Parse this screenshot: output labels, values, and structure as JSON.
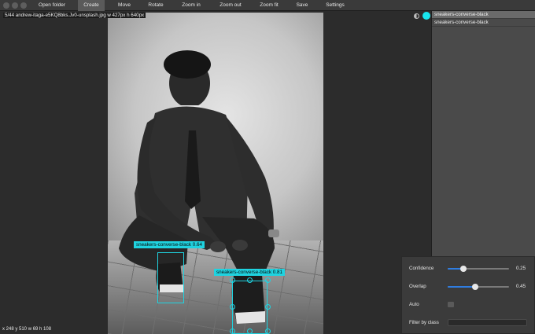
{
  "toolbar": {
    "items": [
      {
        "label": "Open folder",
        "active": false
      },
      {
        "label": "Create",
        "active": true
      },
      {
        "label": "Move",
        "active": false
      },
      {
        "label": "Rotate",
        "active": false
      },
      {
        "label": "Zoom in",
        "active": false
      },
      {
        "label": "Zoom out",
        "active": false
      },
      {
        "label": "Zoom fit",
        "active": false
      },
      {
        "label": "Save",
        "active": false
      },
      {
        "label": "Settings",
        "active": false
      }
    ]
  },
  "canvas": {
    "file_info": "5/44 andrew-itaga-e5KQ8bks.Jv0-unsplash.jpg w 427px h 640px",
    "cursor_readout": "x 248 y 510 w 69 h 108"
  },
  "detections": [
    {
      "label": "sneakers-converse-black 0.64",
      "class": "sneakers-converse-black",
      "confidence": 0.64
    },
    {
      "label": "sneakers-converse-black 0.81",
      "class": "sneakers-converse-black",
      "confidence": 0.81
    }
  ],
  "class_list": {
    "items": [
      {
        "label": "sneakers-converse-black",
        "selected": true
      },
      {
        "label": "sneakers-converse-black",
        "selected": false
      }
    ],
    "active_color": "#18e6ee"
  },
  "settings": {
    "confidence": {
      "label": "Confidence",
      "value": "0.25",
      "fraction": 0.25
    },
    "overlap": {
      "label": "Overlap",
      "value": "0.45",
      "fraction": 0.45
    },
    "auto": {
      "label": "Auto",
      "checked": false
    },
    "filter": {
      "label": "Filter by class",
      "value": ""
    }
  },
  "icons": {
    "window_controls": [
      "close-dot",
      "minimize-dot",
      "zoom-dot"
    ],
    "contrast": "contrast-icon",
    "color": "color-dot"
  }
}
